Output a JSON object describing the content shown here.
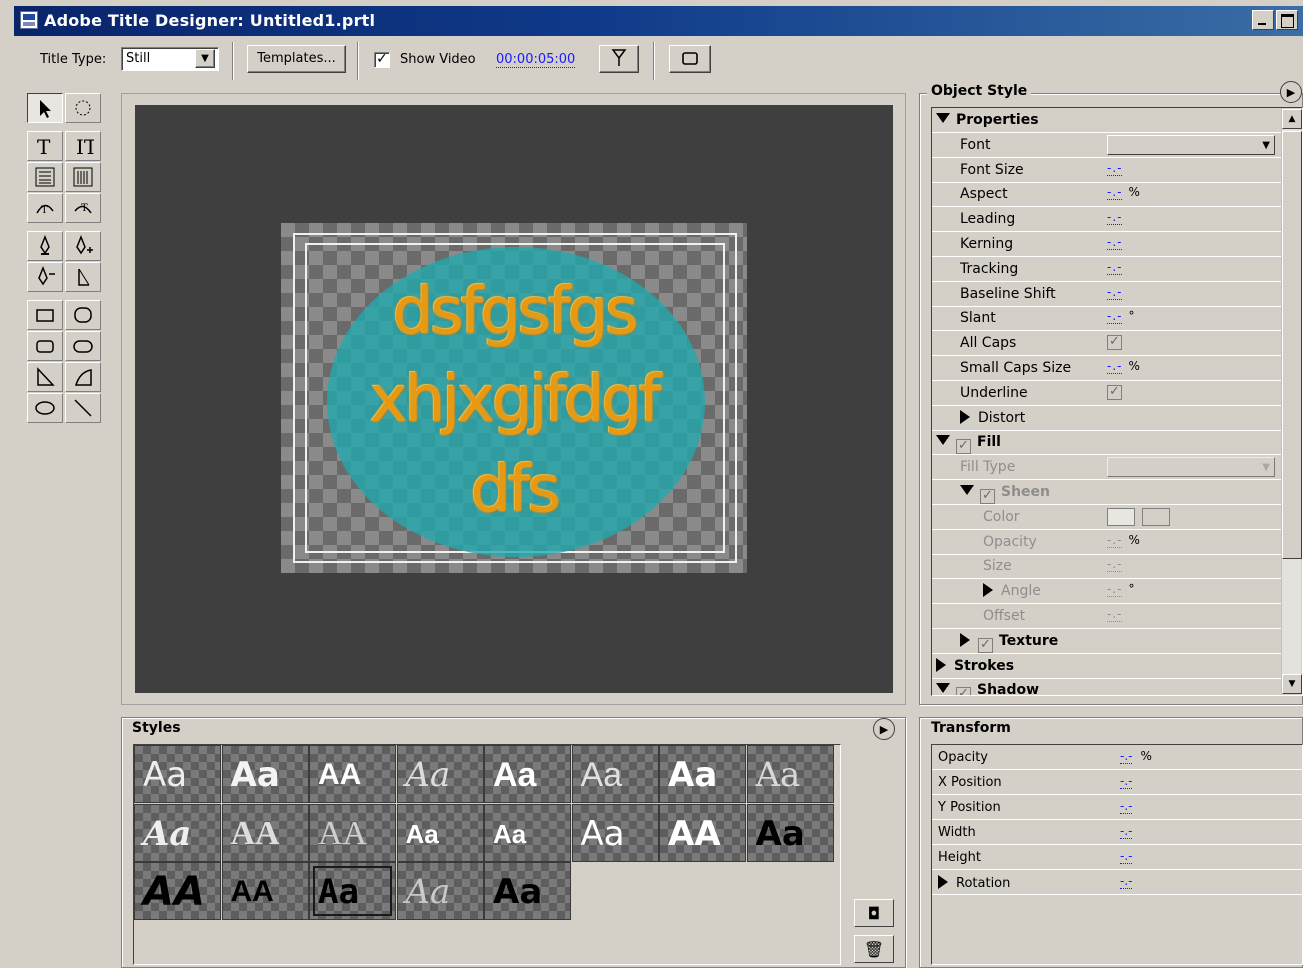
{
  "window": {
    "title": "Adobe Title Designer: Untitled1.prtl"
  },
  "toolbar": {
    "title_type_label": "Title Type:",
    "title_type_value": "Still",
    "templates_label": "Templates...",
    "show_video_label": "Show Video",
    "show_video_checked": true,
    "timecode": "00:00:05:00",
    "marker_icon": "marker-icon",
    "safe_area_icon": "safe-area-icon"
  },
  "tools": [
    {
      "name": "selection-tool-icon"
    },
    {
      "name": "rotation-tool-icon"
    },
    {
      "name": "type-tool-icon"
    },
    {
      "name": "vertical-type-tool-icon"
    },
    {
      "name": "area-type-tool-icon"
    },
    {
      "name": "vertical-area-type-tool-icon"
    },
    {
      "name": "path-type-tool-icon"
    },
    {
      "name": "vertical-path-type-tool-icon"
    },
    {
      "name": "pen-tool-icon"
    },
    {
      "name": "add-anchor-point-tool-icon"
    },
    {
      "name": "delete-anchor-point-tool-icon"
    },
    {
      "name": "convert-anchor-point-tool-icon"
    },
    {
      "name": "rectangle-tool-icon"
    },
    {
      "name": "rounded-corner-rectangle-tool-icon"
    },
    {
      "name": "clipped-corner-rectangle-tool-icon"
    },
    {
      "name": "rounded-rectangle-tool-icon"
    },
    {
      "name": "wedge-tool-icon"
    },
    {
      "name": "arc-tool-icon"
    },
    {
      "name": "ellipse-tool-icon"
    },
    {
      "name": "line-tool-icon"
    }
  ],
  "canvas": {
    "lines": [
      "dsfgsfgs",
      "xhjxgjfdgf",
      "dfs"
    ],
    "text_color": "#e69a14",
    "ellipse_color": "#20aaaf",
    "background_color": "#3f3f3f"
  },
  "styles": {
    "title": "Styles",
    "swatch_label": "Aa",
    "swatches": [
      {
        "text": "Aa"
      },
      {
        "text": "Aa"
      },
      {
        "text": "AA"
      },
      {
        "text": "Aa"
      },
      {
        "text": "Aa"
      },
      {
        "text": "Aa"
      },
      {
        "text": "Aa"
      },
      {
        "text": "Aa"
      },
      {
        "text": "Aa"
      },
      {
        "text": "AA"
      },
      {
        "text": "AA"
      },
      {
        "text": "Aa"
      },
      {
        "text": "Aa"
      },
      {
        "text": "Aa"
      },
      {
        "text": "AA"
      },
      {
        "text": "Aa"
      },
      {
        "text": "AA"
      },
      {
        "text": "AA"
      },
      {
        "text": "Aa"
      },
      {
        "text": "Aa"
      },
      {
        "text": "Aa"
      }
    ],
    "selected_index": 18
  },
  "object_style": {
    "title": "Object Style",
    "rows": [
      {
        "label": "Properties",
        "kind": "section",
        "expanded": true
      },
      {
        "label": "Font",
        "kind": "dropdown"
      },
      {
        "label": "Font Size",
        "value": "-.-"
      },
      {
        "label": "Aspect",
        "value": "-.-",
        "unit": "%"
      },
      {
        "label": "Leading",
        "value": "-.-"
      },
      {
        "label": "Kerning",
        "value": "-.-"
      },
      {
        "label": "Tracking",
        "value": "-.-"
      },
      {
        "label": "Baseline Shift",
        "value": "-.-"
      },
      {
        "label": "Slant",
        "value": "-.-",
        "unit": "°"
      },
      {
        "label": "All Caps",
        "kind": "check",
        "checked": true
      },
      {
        "label": "Small Caps Size",
        "value": "-.-",
        "unit": "%"
      },
      {
        "label": "Underline",
        "kind": "check",
        "checked": true
      },
      {
        "label": "Distort",
        "kind": "collapsed"
      },
      {
        "label": "Fill",
        "kind": "section-check",
        "expanded": true
      },
      {
        "label": "Fill Type",
        "kind": "dropdown",
        "disabled": true
      },
      {
        "label": "Sheen",
        "kind": "subsection-check",
        "expanded": true,
        "disabled": true
      },
      {
        "label": "Color",
        "kind": "color",
        "disabled": true
      },
      {
        "label": "Opacity",
        "value": "-.-",
        "unit": "%",
        "disabled": true
      },
      {
        "label": "Size",
        "value": "-.-",
        "disabled": true
      },
      {
        "label": "Angle",
        "value": "-.-",
        "unit": "°",
        "disabled": true,
        "collapsed": true
      },
      {
        "label": "Offset",
        "value": "-.-",
        "disabled": true
      },
      {
        "label": "Texture",
        "kind": "subsection-check",
        "expanded": false
      },
      {
        "label": "Strokes",
        "kind": "section",
        "expanded": false
      },
      {
        "label": "Shadow",
        "kind": "section-check",
        "expanded": true
      }
    ]
  },
  "transform": {
    "title": "Transform",
    "rows": [
      {
        "label": "Opacity",
        "value": "-.-",
        "unit": "%"
      },
      {
        "label": "X Position",
        "value": "-.-"
      },
      {
        "label": "Y Position",
        "value": "-.-"
      },
      {
        "label": "Width",
        "value": "-.-"
      },
      {
        "label": "Height",
        "value": "-.-"
      },
      {
        "label": "Rotation",
        "value": "-.-",
        "collapsed": true
      }
    ]
  }
}
